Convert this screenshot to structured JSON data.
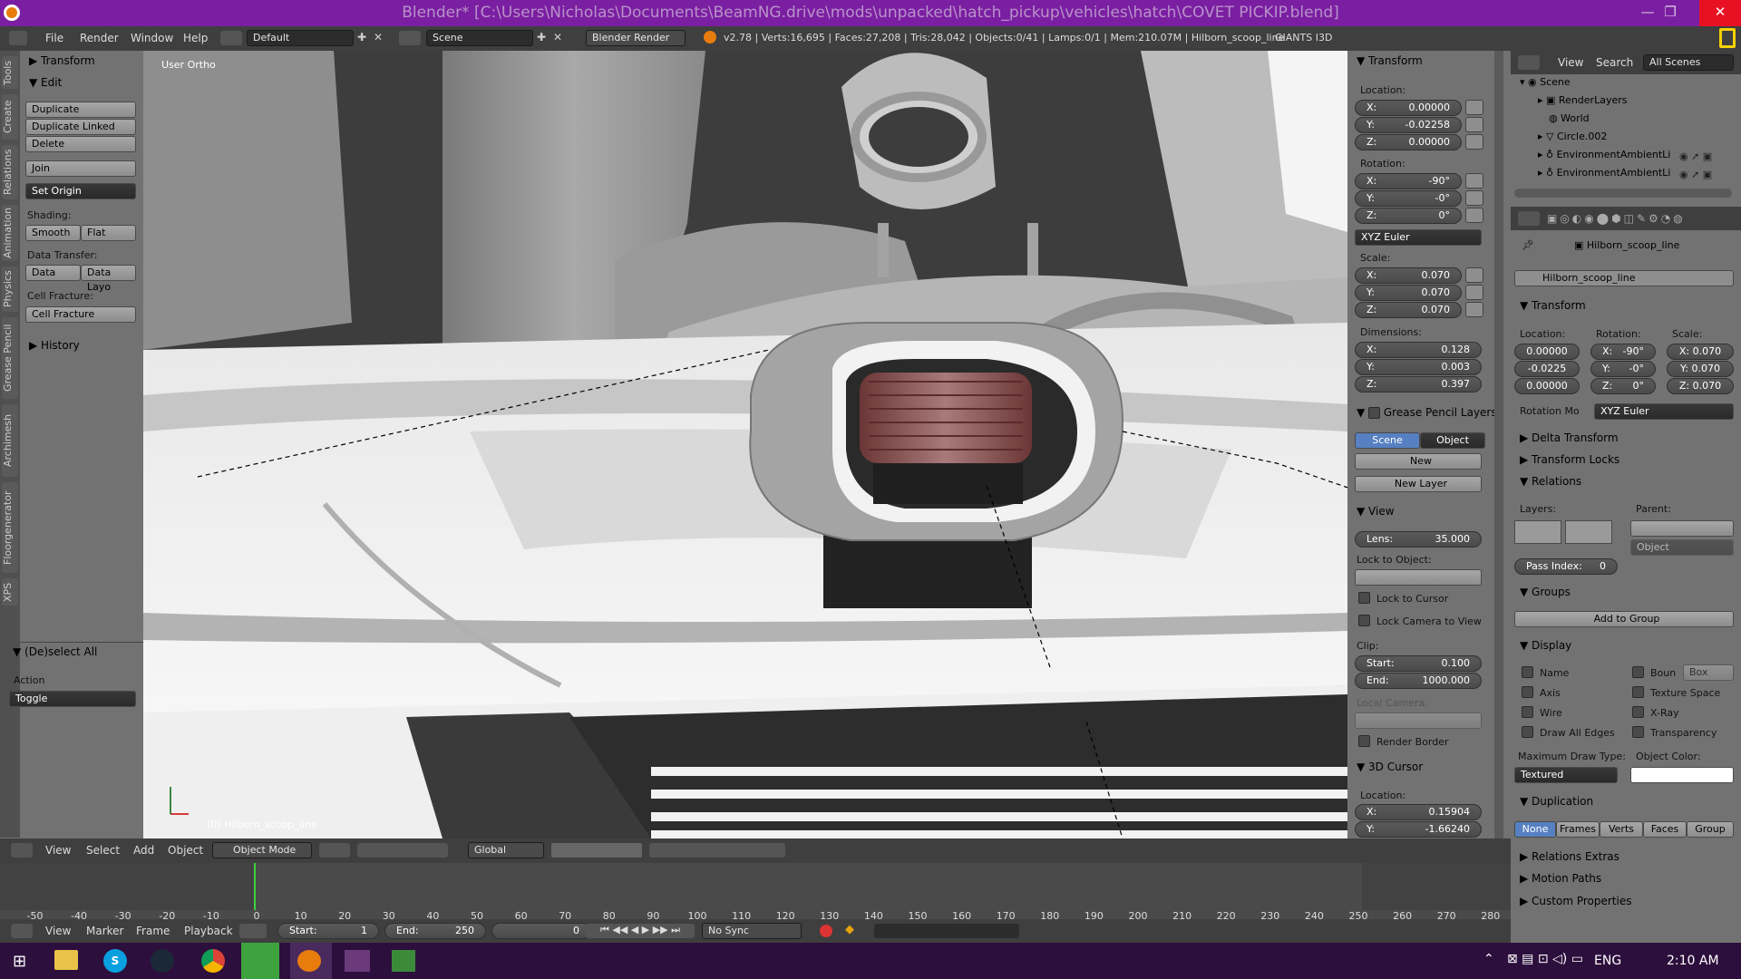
{
  "window": {
    "title": "Blender* [C:\\Users\\Nicholas\\Documents\\BeamNG.drive\\mods\\unpacked\\hatch_pickup\\vehicles\\hatch\\COVET PICKIP.blend]",
    "minimize": "—",
    "maximize": "❐",
    "close": "✕"
  },
  "menubar": {
    "file": "File",
    "render": "Render",
    "window": "Window",
    "help": "Help",
    "layout": "Default",
    "scene": "Scene",
    "engine": "Blender Render",
    "stats": "v2.78 | Verts:16,695 | Faces:27,208 | Tris:28,042 | Objects:0/41 | Lamps:0/1 | Mem:210.07M | Hilborn_scoop_line",
    "extra": "GIANTS I3D"
  },
  "tool_tabs": [
    "Tools",
    "Create",
    "Relations",
    "Animation",
    "Physics",
    "Grease Pencil",
    "Archimesh",
    "Floorgenerator",
    "XPS"
  ],
  "tools": {
    "transform": "Transform",
    "edit": "Edit",
    "duplicate": "Duplicate",
    "duplicate_linked": "Duplicate Linked",
    "delete": "Delete",
    "join": "Join",
    "set_origin": "Set Origin",
    "shading": "Shading:",
    "smooth": "Smooth",
    "flat": "Flat",
    "data_transfer": "Data Transfer:",
    "data": "Data",
    "data_layo": "Data Layo",
    "cell_fracture_label": "Cell Fracture:",
    "cell_fracture": "Cell Fracture",
    "history": "History",
    "deselect_all": "(De)select All",
    "action": "Action",
    "toggle": "Toggle"
  },
  "viewport": {
    "view_label": "User Ortho",
    "object_label": "(0) Hilborn_scoop_line"
  },
  "npanel": {
    "transform": "Transform",
    "location": "Location:",
    "loc": [
      {
        "k": "X:",
        "v": "0.00000"
      },
      {
        "k": "Y:",
        "v": "-0.02258"
      },
      {
        "k": "Z:",
        "v": "0.00000"
      }
    ],
    "rotation": "Rotation:",
    "rot": [
      {
        "k": "X:",
        "v": "-90°"
      },
      {
        "k": "Y:",
        "v": "-0°"
      },
      {
        "k": "Z:",
        "v": "0°"
      }
    ],
    "euler": "XYZ Euler",
    "scale": "Scale:",
    "scl": [
      {
        "k": "X:",
        "v": "0.070"
      },
      {
        "k": "Y:",
        "v": "0.070"
      },
      {
        "k": "Z:",
        "v": "0.070"
      }
    ],
    "dimensions": "Dimensions:",
    "dim": [
      {
        "k": "X:",
        "v": "0.128"
      },
      {
        "k": "Y:",
        "v": "0.003"
      },
      {
        "k": "Z:",
        "v": "0.397"
      }
    ],
    "gp_layers": "Grease Pencil Layers",
    "scene": "Scene",
    "object": "Object",
    "new": "New",
    "new_layer": "New Layer",
    "view": "View",
    "lens_k": "Lens:",
    "lens_v": "35.000",
    "lock_to_object": "Lock to Object:",
    "lock_to_cursor": "Lock to Cursor",
    "lock_camera": "Lock Camera to View",
    "clip": "Clip:",
    "start_k": "Start:",
    "start_v": "0.100",
    "end_k": "End:",
    "end_v": "1000.000",
    "local_camera": "Local Camera:",
    "render_border": "Render Border",
    "cursor3d": "3D Cursor",
    "cursor_location": "Location:",
    "cur": [
      {
        "k": "X:",
        "v": "0.15904"
      },
      {
        "k": "Y:",
        "v": "-1.66240"
      }
    ]
  },
  "outliner": {
    "view": "View",
    "search": "Search",
    "all_scenes": "All Scenes",
    "items": [
      "Scene",
      "RenderLayers",
      "World",
      "Circle.002",
      "EnvironmentAmbientLi",
      "EnvironmentAmbientLi"
    ]
  },
  "props": {
    "breadcrumb": "Hilborn_scoop_line",
    "name": "Hilborn_scoop_line",
    "transform": "Transform",
    "location": "Location:",
    "rotation": "Rotation:",
    "scale": "Scale:",
    "loc": [
      "0.00000",
      "-0.0225",
      "0.00000"
    ],
    "rot": [
      {
        "k": "X:",
        "v": "-90°"
      },
      {
        "k": "Y:",
        "v": "-0°"
      },
      {
        "k": "Z:",
        "v": "0°"
      }
    ],
    "scl": [
      "X: 0.070",
      "Y: 0.070",
      "Z: 0.070"
    ],
    "rotation_mode": "Rotation Mo",
    "euler": "XYZ Euler",
    "delta_transform": "Delta Transform",
    "transform_locks": "Transform Locks",
    "relations": "Relations",
    "layers": "Layers:",
    "parent": "Parent:",
    "object": "Object",
    "pass_index_k": "Pass Index:",
    "pass_index_v": "0",
    "groups": "Groups",
    "add_to_group": "Add to Group",
    "display": "Display",
    "name_lbl": "Name",
    "boun": "Boun",
    "box": "Box",
    "axis": "Axis",
    "texture_space": "Texture Space",
    "wire": "Wire",
    "xray": "X-Ray",
    "draw_all_edges": "Draw All Edges",
    "transparency": "Transparency",
    "max_draw_type": "Maximum Draw Type:",
    "object_color": "Object Color:",
    "textured": "Textured",
    "duplication": "Duplication",
    "dup": [
      "None",
      "Frames",
      "Verts",
      "Faces",
      "Group"
    ],
    "relations_extras": "Relations Extras",
    "motion_paths": "Motion Paths",
    "custom_properties": "Custom Properties"
  },
  "vheader": {
    "view": "View",
    "select": "Select",
    "add": "Add",
    "object": "Object",
    "mode": "Object Mode",
    "orientation": "Global"
  },
  "timeline": {
    "ticks": [
      "-50",
      "-40",
      "-30",
      "-20",
      "-10",
      "0",
      "10",
      "20",
      "30",
      "40",
      "50",
      "60",
      "70",
      "80",
      "90",
      "100",
      "110",
      "120",
      "130",
      "140",
      "150",
      "160",
      "170",
      "180",
      "190",
      "200",
      "210",
      "220",
      "230",
      "240",
      "250",
      "260",
      "270",
      "280"
    ],
    "view": "View",
    "marker": "Marker",
    "frame": "Frame",
    "playback": "Playback",
    "start_k": "Start:",
    "start_v": "1",
    "end_k": "End:",
    "end_v": "250",
    "current": "0",
    "sync": "No Sync"
  },
  "taskbar": {
    "lang": "ENG",
    "time": "2:10 AM"
  }
}
